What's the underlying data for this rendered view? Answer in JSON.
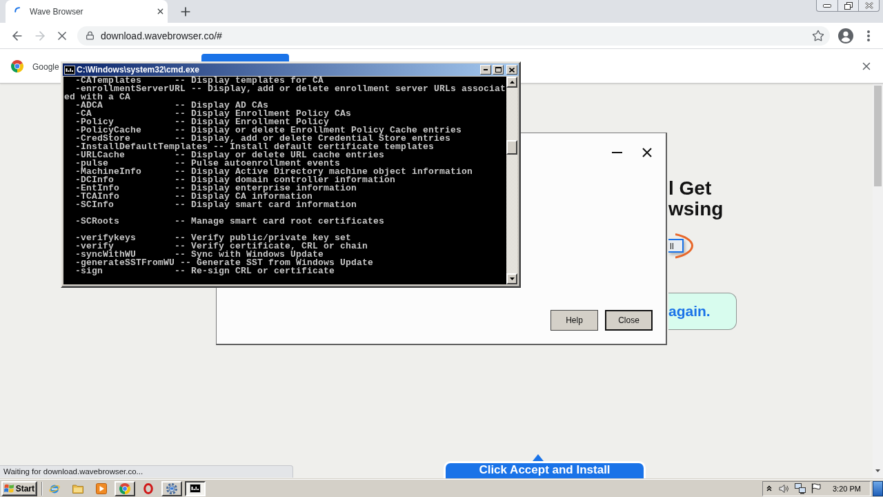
{
  "browser": {
    "tabs": [
      {
        "title": "Wave Browser",
        "selected": true
      }
    ],
    "nav_buttons": [
      {
        "kind": "back",
        "disabled": false
      },
      {
        "kind": "forward",
        "disabled": true
      },
      {
        "kind": "stop",
        "disabled": false
      }
    ],
    "address": "download.wavebrowser.co/#"
  },
  "infobar": {
    "text": "Google"
  },
  "page": {
    "heading_lines": [
      "l Get",
      "wsing"
    ],
    "install_button": "ll",
    "notice": "again.",
    "callout": "Click Accept and Install",
    "status": "Waiting for download.wavebrowser.co..."
  },
  "console_window": {
    "title": "C:\\Windows\\system32\\cmd.exe",
    "blocks": [
      [
        "  -CATemplates      -- Display templates for CA",
        "  -enrollmentServerURL -- Display, add or delete enrollment server URLs associat",
        "ed with a CA",
        "  -ADCA             -- Display AD CAs",
        "  -CA               -- Display Enrollment Policy CAs",
        "  -Policy           -- Display Enrollment Policy",
        "  -PolicyCache      -- Display or delete Enrollment Policy Cache entries",
        "  -CredStore        -- Display, add or delete Credential Store entries",
        "  -InstallDefaultTemplates -- Install default certificate templates",
        "  -URLCache         -- Display or delete URL cache entries",
        "  -pulse            -- Pulse autoenrollment events",
        "  -MachineInfo      -- Display Active Directory machine object information",
        "  -DCInfo           -- Display domain controller information",
        "  -EntInfo          -- Display enterprise information",
        "  -TCAInfo          -- Display CA information",
        "  -SCInfo           -- Display smart card information"
      ],
      [
        "  -SCRoots          -- Manage smart card root certificates"
      ],
      [
        "  -verifykeys       -- Verify public/private key set",
        "  -verify           -- Verify certificate, CRL or chain",
        "  -syncWithWU       -- Sync with Windows Update",
        "  -generateSSTFromWU -- Generate SST from Windows Update",
        "  -sign             -- Re-sign CRL or certificate"
      ]
    ]
  },
  "dialog": {
    "buttons": [
      {
        "label": "Help",
        "default": false
      },
      {
        "label": "Close",
        "default": true
      }
    ]
  },
  "taskbar": {
    "start": "Start",
    "apps": [
      {
        "kind": "ie",
        "open": false,
        "selected": false
      },
      {
        "kind": "folder",
        "open": false,
        "selected": false
      },
      {
        "kind": "media",
        "open": false,
        "selected": false
      },
      {
        "kind": "chrome",
        "open": true,
        "selected": false
      },
      {
        "kind": "opera",
        "open": false,
        "selected": false
      },
      {
        "kind": "tool",
        "open": true,
        "selected": false
      },
      {
        "kind": "cmd",
        "open": true,
        "selected": true
      }
    ],
    "clock": "3:20 PM"
  }
}
